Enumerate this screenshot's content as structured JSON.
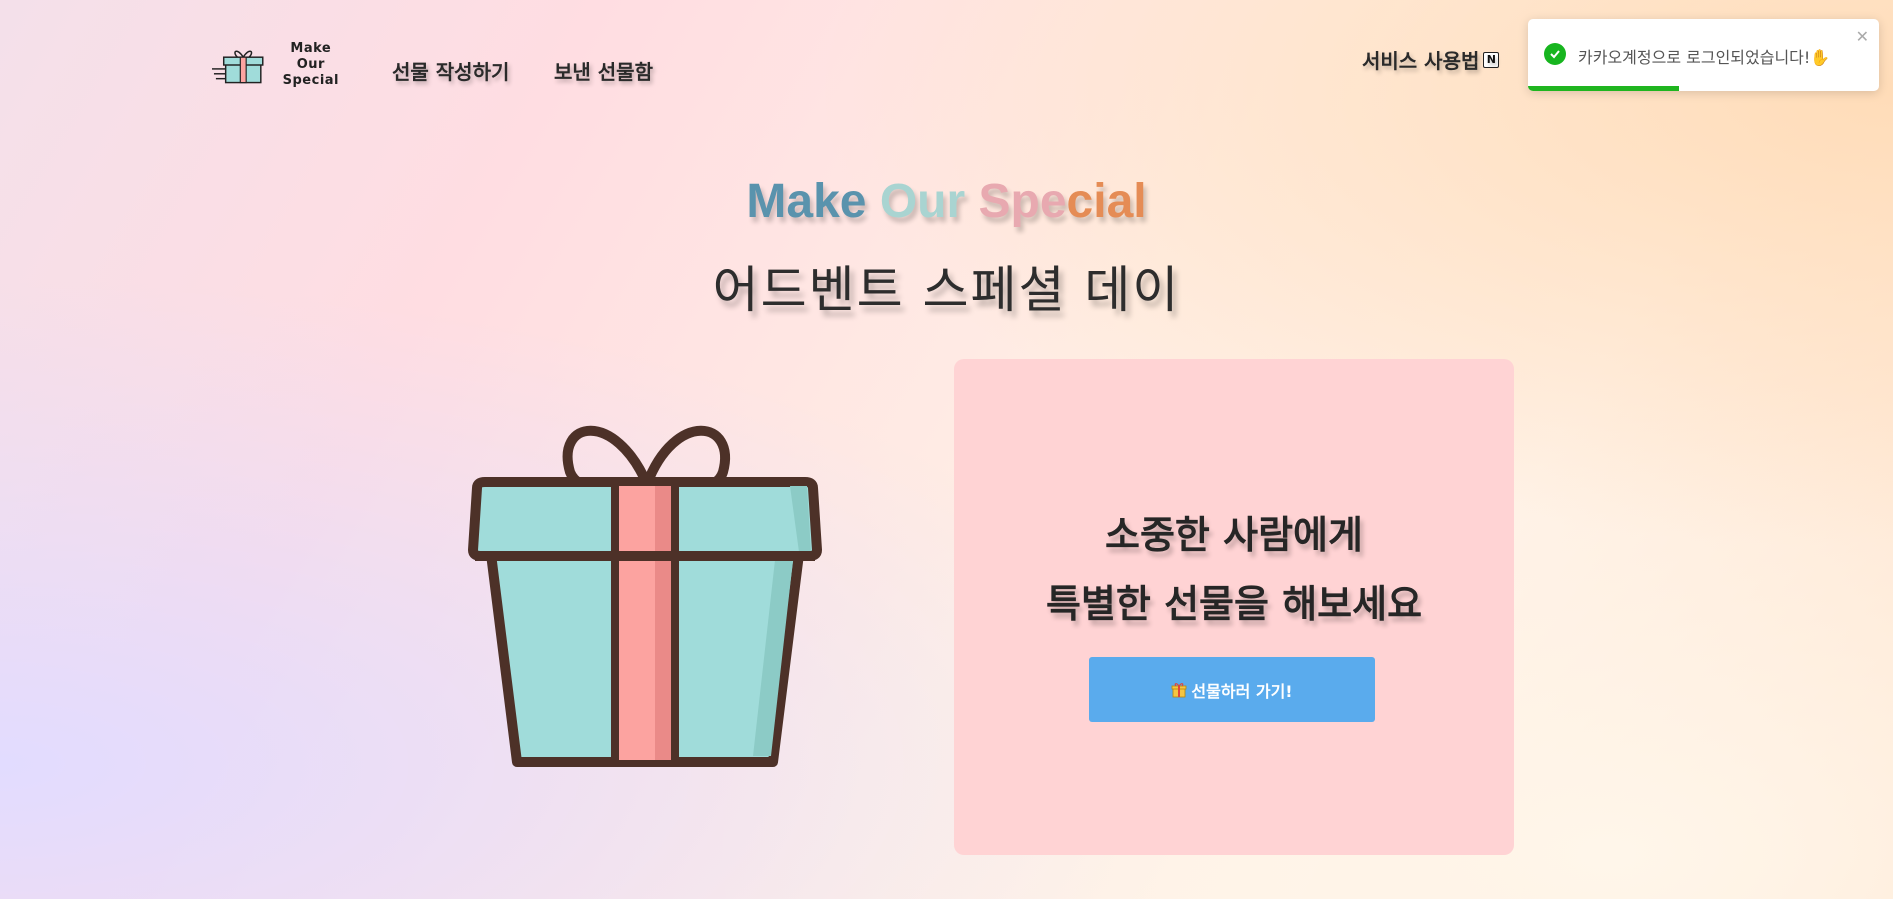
{
  "nav": {
    "logo_line1": "Make Our",
    "logo_line2": "Special",
    "write_gift": "선물 작성하기",
    "sent_gifts": "보낸 선물함",
    "service_guide": "서비스 사용법",
    "notion_icon": "N"
  },
  "toast": {
    "message": "카카오계정으로 로그인되었습니다!✋",
    "close": "✕",
    "progress": 0.43,
    "status_color": "#17b51f"
  },
  "hero": {
    "title_word1": "Make",
    "title_word2": "Our",
    "title_word3a": "Spe",
    "title_word3b": "cial",
    "subtitle": "어드벤트 스페셜 데이"
  },
  "card": {
    "line1": "소중한 사람에게",
    "line2": "특별한 선물을 해보세요",
    "button_label": "선물하러 가기!",
    "button_icon": "gift-icon"
  },
  "colors": {
    "gift_teal": "#a0dcda",
    "gift_ribbon": "#fca3a0",
    "outline": "#4d3128",
    "card_bg": "#ffd3d4",
    "button_bg": "#5aabed"
  }
}
